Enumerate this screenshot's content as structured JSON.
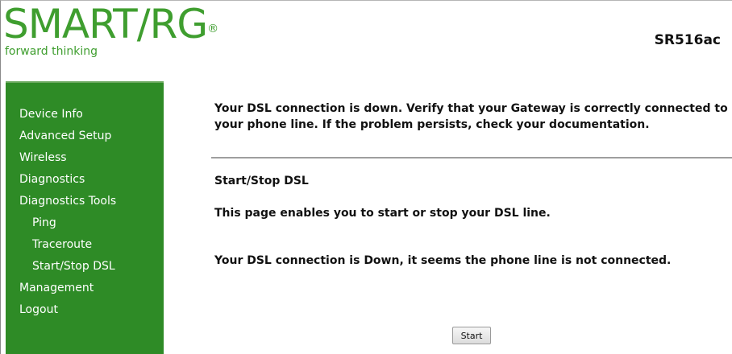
{
  "header": {
    "logo_text": "SMART/RG",
    "logo_registered": "®",
    "tagline": "forward thinking",
    "model": "SR516ac"
  },
  "sidebar": {
    "items": [
      {
        "label": "Device Info"
      },
      {
        "label": "Advanced Setup"
      },
      {
        "label": "Wireless"
      },
      {
        "label": "Diagnostics"
      },
      {
        "label": "Diagnostics Tools"
      },
      {
        "label": "Ping"
      },
      {
        "label": "Traceroute"
      },
      {
        "label": "Start/Stop DSL"
      },
      {
        "label": "Management"
      },
      {
        "label": "Logout"
      }
    ]
  },
  "main": {
    "warning": "Your DSL connection is down. Verify that your Gateway is correctly connected to your phone line. If the problem persists, check your documentation.",
    "section_title": "Start/Stop DSL",
    "description": "This page enables you to start or stop your DSL line.",
    "status": "Your DSL connection is Down, it seems the phone line is not connected.",
    "start_button": "Start"
  },
  "colors": {
    "brand_green": "#3f9e2f",
    "sidebar_green": "#2e8b26"
  }
}
